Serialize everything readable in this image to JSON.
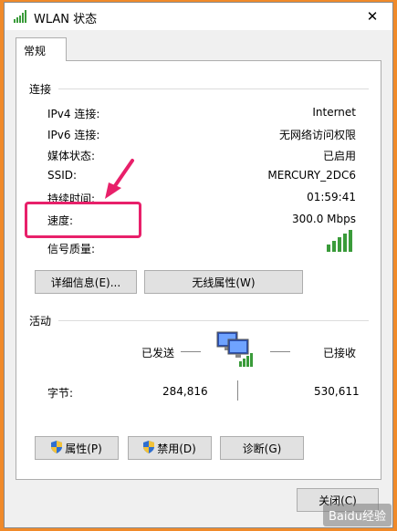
{
  "window": {
    "title": "WLAN 状态",
    "close_glyph": "✕"
  },
  "tabs": [
    {
      "label": "常规"
    }
  ],
  "connection": {
    "section_label": "连接",
    "rows": [
      {
        "label": "IPv4 连接:",
        "value": "Internet"
      },
      {
        "label": "IPv6 连接:",
        "value": "无网络访问权限"
      },
      {
        "label": "媒体状态:",
        "value": "已启用"
      },
      {
        "label": "SSID:",
        "value": "MERCURY_2DC6"
      },
      {
        "label": "持续时间:",
        "value": "01:59:41"
      },
      {
        "label": "速度:",
        "value": "300.0 Mbps"
      }
    ],
    "signal_label": "信号质量:",
    "signal_bars_filled": 5,
    "signal_bars_total": 5
  },
  "buttons": {
    "details": "详细信息(E)...",
    "wireless_properties": "无线属性(W)",
    "properties": "属性(P)",
    "disable": "禁用(D)",
    "diagnose": "诊断(G)",
    "close": "关闭(C)"
  },
  "activity": {
    "section_label": "活动",
    "sent_label": "已发送",
    "received_label": "已接收",
    "bytes_label": "字节:",
    "bytes_sent": "284,816",
    "bytes_received": "530,611"
  },
  "watermark": "Baidu经验",
  "colors": {
    "background": "#f08a2a",
    "highlight": "#e8206a",
    "signal": "#3a9b3a"
  }
}
